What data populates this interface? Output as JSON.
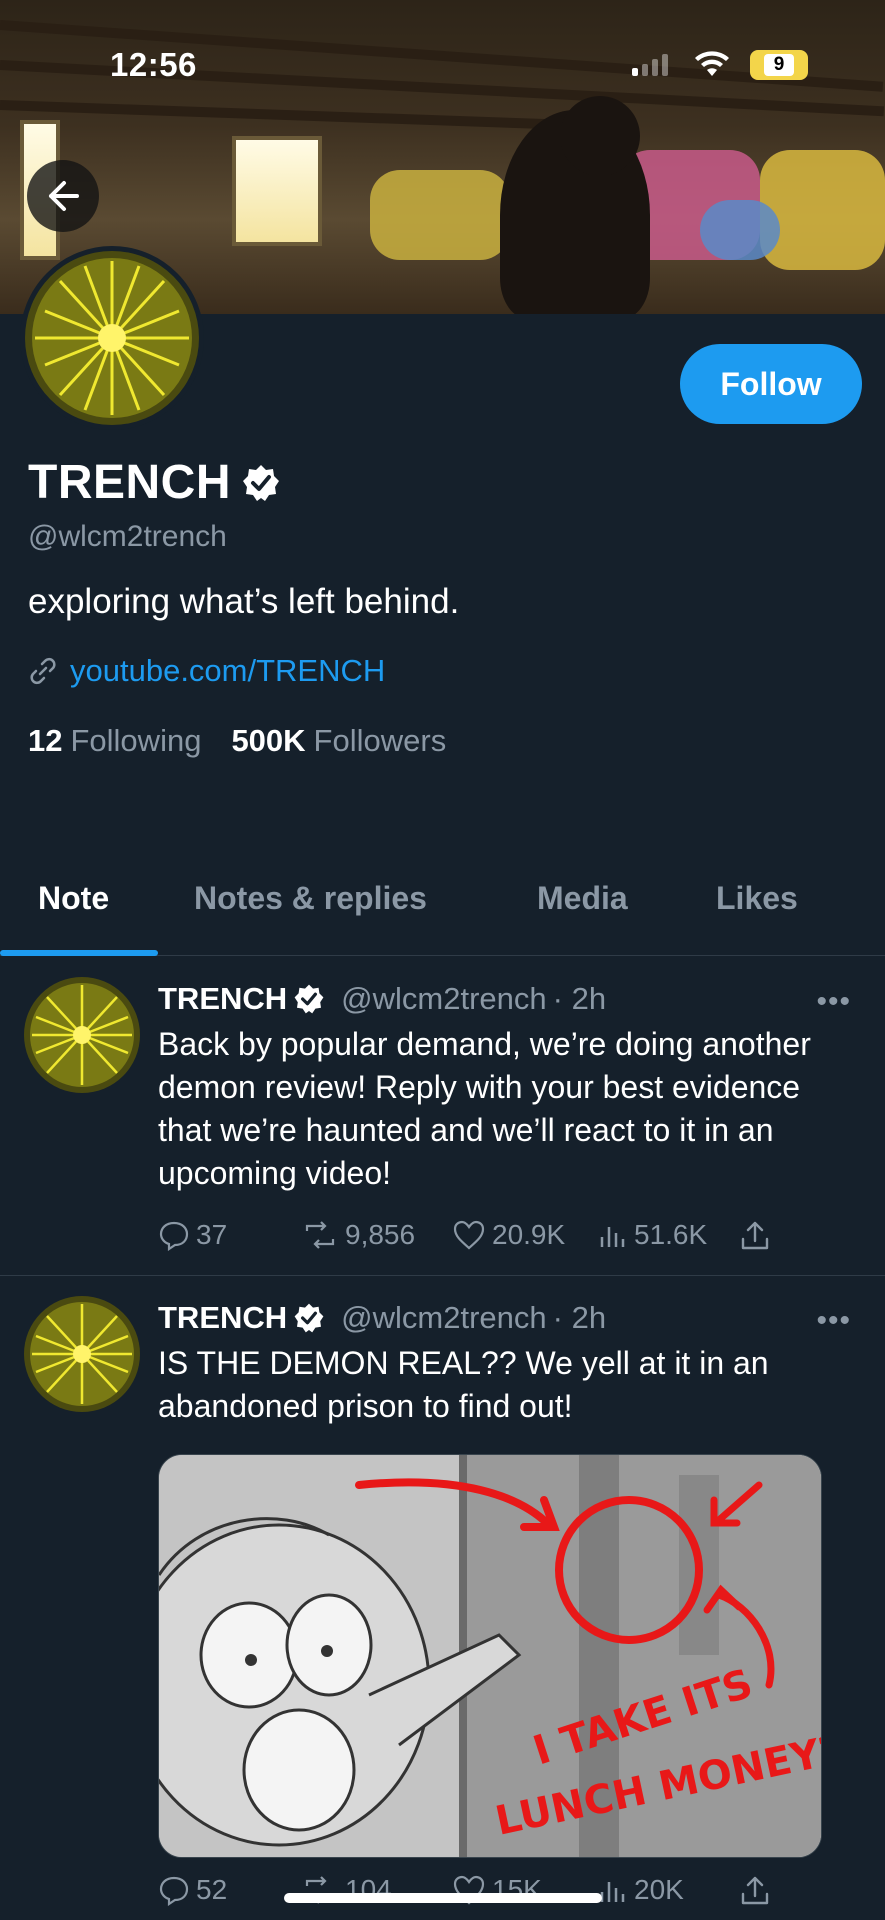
{
  "status_bar": {
    "time": "12:56",
    "battery": "9"
  },
  "profile": {
    "display_name": "TRENCH",
    "handle": "@wlcm2trench",
    "bio": "exploring what’s left behind.",
    "link": "youtube.com/TRENCH",
    "following_count": "12",
    "following_label": "Following",
    "followers_count": "500K",
    "followers_label": "Followers",
    "follow_button": "Follow"
  },
  "tabs": [
    {
      "label": "Note",
      "active": true
    },
    {
      "label": "Notes & replies",
      "active": false
    },
    {
      "label": "Media",
      "active": false
    },
    {
      "label": "Likes",
      "active": false
    }
  ],
  "posts": [
    {
      "name": "TRENCH",
      "handle": "@wlcm2trench",
      "time": "· 2h",
      "more": "•••",
      "text": "Back by popular demand, we’re doing another demon review! Reply with your best evidence that we’re haunted and we’ll react to it in an upcoming video!",
      "replies": "37",
      "reposts": "9,856",
      "likes": "20.9K",
      "views": "51.6K"
    },
    {
      "name": "TRENCH",
      "handle": "@wlcm2trench",
      "time": "· 2h",
      "more": "•••",
      "text": "IS THE DEMON REAL?? We yell at it in an abandoned prison to find out!",
      "media_caption_line1": "I TAKE ITS",
      "media_caption_line2": "LUNCH MONEY?!",
      "replies": "52",
      "reposts": "104",
      "likes": "15K",
      "views": "20K"
    }
  ],
  "colors": {
    "background": "#15202b",
    "accent": "#1d9bf0",
    "muted": "#8b98a5",
    "avatar_yellow": "#e8e020"
  }
}
